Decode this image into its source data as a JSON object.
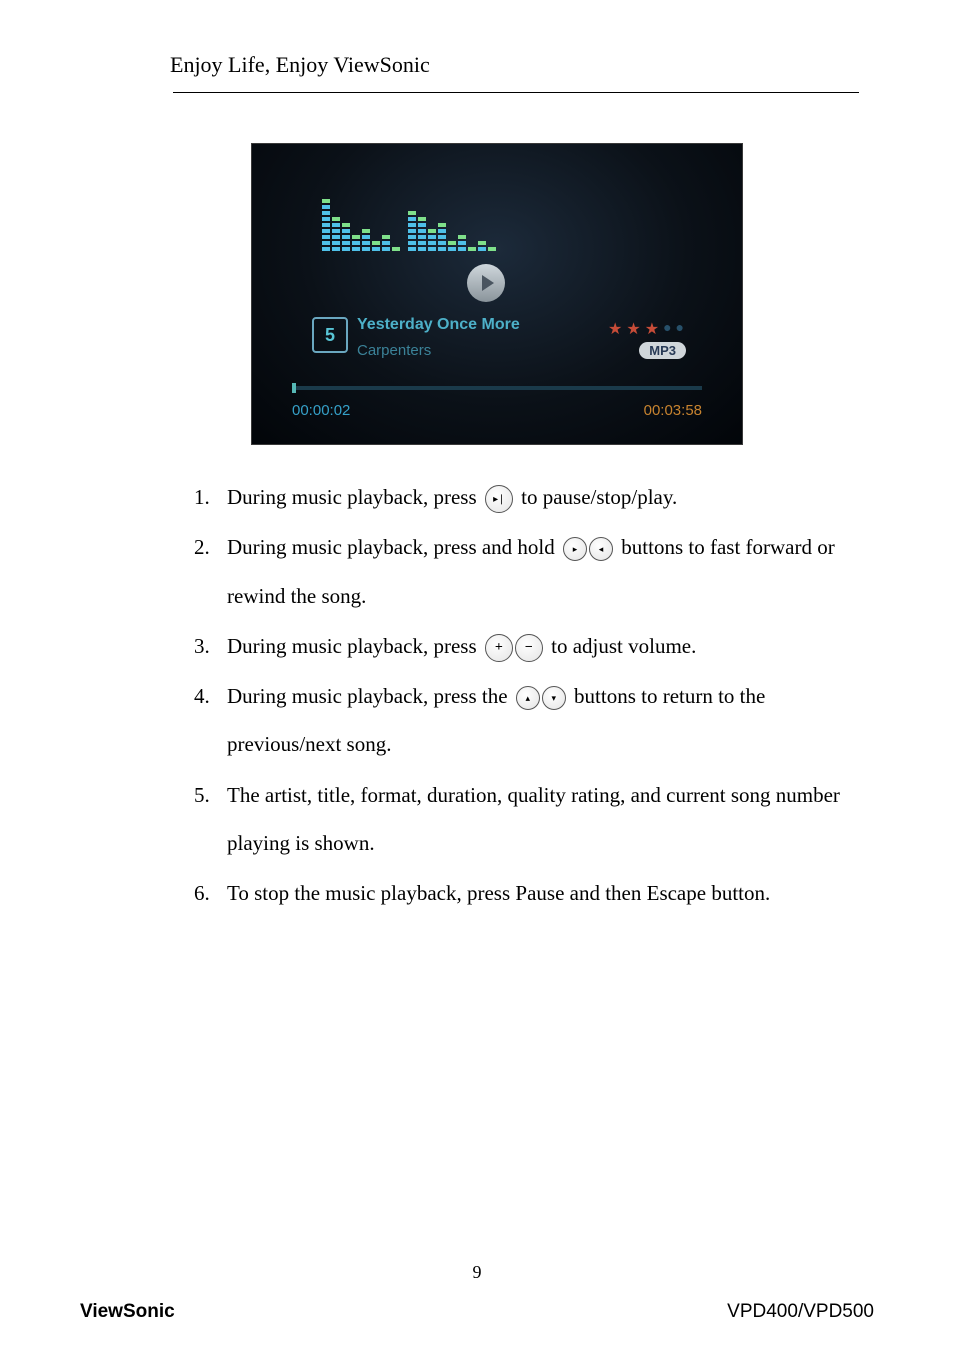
{
  "header": {
    "title": "Enjoy Life, Enjoy ViewSonic"
  },
  "screenshot": {
    "track_number": "5",
    "title": "Yesterday Once More",
    "artist": "Carpenters",
    "format": "MP3",
    "elapsed": "00:00:02",
    "duration": "00:03:58",
    "rating_full": 3,
    "rating_total": 5
  },
  "steps": {
    "s1a": "During music playback, press ",
    "s1b": " to pause/stop/play.",
    "s2a": "During music playback, press and hold ",
    "s2b": " buttons to fast forward or rewind the song.",
    "s3a": "During music playback, press",
    "s3b": " to adjust volume.",
    "s4a": "During music playback, press the ",
    "s4b": " buttons to return to the previous/next song.",
    "s5": "The artist, title, format, duration, quality rating, and current song number playing is shown.",
    "s6": "To stop the music playback, press Pause and then Escape button."
  },
  "page_number": "9",
  "footer": {
    "left": "ViewSonic",
    "right": "VPD400/VPD500"
  }
}
